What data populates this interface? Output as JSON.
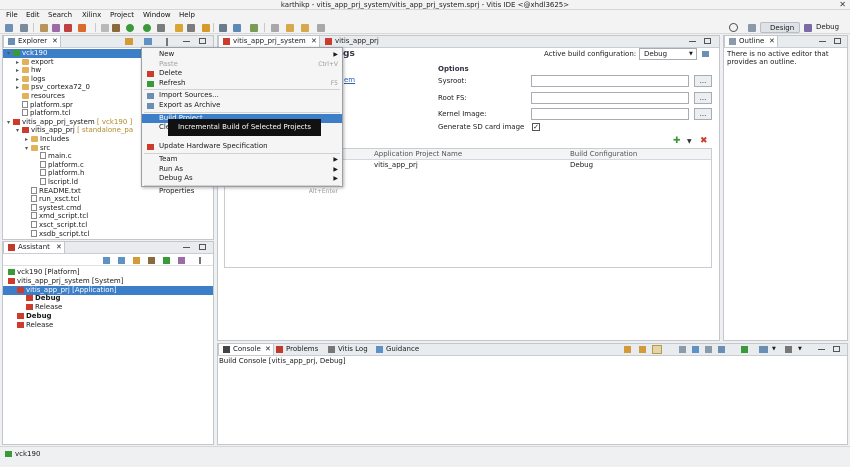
{
  "window": {
    "title": "karthikp - vitis_app_prj_system/vitis_app_prj_system.sprj - Vitis IDE <@xhdl3625>",
    "close": "✕"
  },
  "menubar": [
    "File",
    "Edit",
    "Search",
    "Xilinx",
    "Project",
    "Window",
    "Help"
  ],
  "perspectives": {
    "design": "Design",
    "debug": "Debug"
  },
  "explorer": {
    "tab": "Explorer",
    "items": [
      {
        "label": "vck190",
        "depth": 0,
        "icon": "board"
      },
      {
        "label": "export",
        "depth": 1,
        "icon": "folder"
      },
      {
        "label": "hw",
        "depth": 1,
        "icon": "folder"
      },
      {
        "label": "logs",
        "depth": 1,
        "icon": "folder"
      },
      {
        "label": "psv_cortexa72_0",
        "depth": 1,
        "icon": "folder"
      },
      {
        "label": "resources",
        "depth": 1,
        "icon": "folder"
      },
      {
        "label": "platform.spr",
        "depth": 1,
        "icon": "file"
      },
      {
        "label": "platform.tcl",
        "depth": 1,
        "icon": "file"
      },
      {
        "label": "vitis_app_prj_system",
        "suffix": " [ vck190 ]",
        "depth": 0,
        "icon": "proj"
      },
      {
        "label": "vitis_app_prj",
        "suffix": " [ standalone_pa",
        "depth": 1,
        "icon": "proj"
      },
      {
        "label": "Includes",
        "depth": 2,
        "icon": "folder"
      },
      {
        "label": "src",
        "depth": 2,
        "icon": "folder"
      },
      {
        "label": "main.c",
        "depth": 3,
        "icon": "file"
      },
      {
        "label": "platform.c",
        "depth": 3,
        "icon": "file"
      },
      {
        "label": "platform.h",
        "depth": 3,
        "icon": "file"
      },
      {
        "label": "lscript.ld",
        "depth": 3,
        "icon": "file"
      },
      {
        "label": "README.txt",
        "depth": 2,
        "icon": "file"
      },
      {
        "label": "run_xsct.tcl",
        "depth": 2,
        "icon": "file"
      },
      {
        "label": "systest.cmd",
        "depth": 2,
        "icon": "file"
      },
      {
        "label": "xmd_script.tcl",
        "depth": 2,
        "icon": "file"
      },
      {
        "label": "xsct_script.tcl",
        "depth": 2,
        "icon": "file"
      },
      {
        "label": "xsdb_script.tcl",
        "depth": 2,
        "icon": "file"
      }
    ]
  },
  "assistant": {
    "tab": "Assistant",
    "items": [
      {
        "label": "vck190 [Platform]",
        "depth": 0
      },
      {
        "label": "vitis_app_prj_system [System]",
        "depth": 0
      },
      {
        "label": "vitis_app_prj [Application]",
        "depth": 1
      },
      {
        "label": "Debug",
        "depth": 2,
        "bold": true
      },
      {
        "label": "Release",
        "depth": 2
      },
      {
        "label": "Debug",
        "depth": 1,
        "bold": true
      },
      {
        "label": "Release",
        "depth": 1
      }
    ]
  },
  "context_menu": {
    "items": [
      {
        "label": "New",
        "type": "sub"
      },
      {
        "label": "Paste",
        "shortcut": "Ctrl+V",
        "disabled": true
      },
      {
        "label": "Delete"
      },
      {
        "label": "Refresh",
        "shortcut": "F5"
      },
      {
        "sep": true
      },
      {
        "label": "Import Sources..."
      },
      {
        "label": "Export as Archive"
      },
      {
        "sep": true
      },
      {
        "label": "Build Project",
        "highlight": true
      },
      {
        "label": "Cle"
      },
      {
        "label": ""
      },
      {
        "label": "Update Hardware Specification"
      },
      {
        "sep": true
      },
      {
        "label": "Team",
        "type": "sub"
      },
      {
        "label": "Run As",
        "type": "sub"
      },
      {
        "label": "Debug As",
        "type": "sub"
      },
      {
        "sep": true
      },
      {
        "label": "Properties",
        "shortcut": "Alt+Enter"
      }
    ],
    "tooltip": "Incremental Build of Selected Projects"
  },
  "editor": {
    "tabs": [
      "vitis_app_prj_system",
      "vitis_app_prj"
    ],
    "heading_fragment": "gs",
    "link_fragment": "em",
    "active_build_label": "Active build configuration:",
    "active_build_value": "Debug",
    "options_header": "Options",
    "sysroot_label": "Sysroot:",
    "rootfs_label": "Root FS:",
    "kernel_label": "Kernel Image:",
    "sdcard_label": "Generate SD card image",
    "browse": "...",
    "table_headers": [
      "Application Project Name",
      "Build Configuration"
    ],
    "table_rows": [
      {
        "name": "vitis_app_prj",
        "config": "Debug"
      }
    ]
  },
  "outline": {
    "tab": "Outline",
    "message": "There is no active editor that provides an outline."
  },
  "bottom": {
    "tabs": [
      "Console",
      "Problems",
      "Vitis Log",
      "Guidance"
    ],
    "console_text": "Build Console [vitis_app_prj, Debug]"
  },
  "statusbar": {
    "text": "vck190"
  },
  "colors": {
    "selection": "#3d7ec9",
    "accent_green": "#3a9a3a",
    "accent_red": "#cc3b2c"
  }
}
